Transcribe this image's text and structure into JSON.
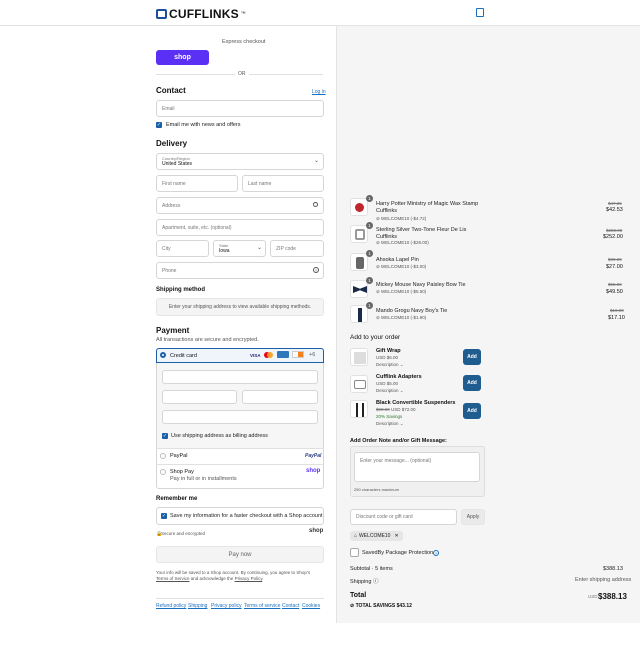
{
  "header": {
    "logo": "CUFFLINKS",
    "logo_suffix": "™",
    "cart_icon": "bag-icon"
  },
  "express": {
    "label": "Express checkout",
    "shop_button": "shop",
    "or": "OR"
  },
  "contact": {
    "title": "Contact",
    "login": "Log in",
    "email_placeholder": "Email",
    "news_label": "Email me with news and offers"
  },
  "delivery": {
    "title": "Delivery",
    "country_label": "Country/Region",
    "country_value": "United States",
    "first_name": "First name",
    "last_name": "Last name",
    "address": "Address",
    "apartment": "Apartment, suite, etc. (optional)",
    "city": "City",
    "state_label": "State",
    "state_value": "Iowa",
    "zip": "ZIP code",
    "phone": "Phone"
  },
  "shipping": {
    "title": "Shipping method",
    "message": "Enter your shipping address to view available shipping methods."
  },
  "payment": {
    "title": "Payment",
    "subtitle": "All transactions are secure and encrypted.",
    "credit_card": "Credit card",
    "more_cards": "+6",
    "billing_label": "Use shipping address as billing address",
    "paypal": "PayPal",
    "paypal_logo": "PayPal",
    "shop_pay": "Shop Pay",
    "shop_pay_sub": "Pay in full or in installments",
    "shop_pay_logo": "shop"
  },
  "remember": {
    "title": "Remember me",
    "save_label": "Save my information for a faster checkout with a Shop account",
    "secure": "Secure and encrypted",
    "shop_logo": "shop"
  },
  "pay_now": "Pay now",
  "legal": {
    "line1": "Your info will be saved to a Shop account. By continuing, you agree to Shop’s",
    "terms": "Terms of Service",
    "and": " and acknowledge the ",
    "privacy": "Privacy Policy",
    "end": "."
  },
  "footer_links": [
    "Refund policy",
    "Shipping",
    "Privacy policy",
    "Terms of service",
    "Contact",
    "Cookies"
  ],
  "order": {
    "items": [
      {
        "name": "Harry Potter Ministry of Magic Wax Stamp Cufflinks",
        "qty": "1",
        "discount": "WELCOME10 (-$4.72)",
        "old": "$47.25",
        "price": "$42.53"
      },
      {
        "name": "Sterling Silver Two-Tone Fleur De Lis Cufflinks",
        "qty": "1",
        "discount": "WELCOME10 (-$28.00)",
        "old": "$280.00",
        "price": "$252.00"
      },
      {
        "name": "Ahsoka Lapel Pin",
        "qty": "1",
        "discount": "WELCOME10 (-$3.00)",
        "old": "$30.00",
        "price": "$27.00"
      },
      {
        "name": "Mickey Mouse Navy Paisley Bow Tie",
        "qty": "1",
        "discount": "WELCOME10 (-$5.50)",
        "old": "$55.00",
        "price": "$49.50"
      },
      {
        "name": "Mando Grogu Navy Boy's Tie",
        "qty": "1",
        "discount": "WELCOME10 (-$1.90)",
        "old": "$19.00",
        "price": "$17.10"
      }
    ],
    "add_title": "Add to your order",
    "upsells": [
      {
        "name": "Gift Wrap",
        "price": "USD $6.00",
        "old": "",
        "savings": "",
        "desc": "Description",
        "btn": "Add"
      },
      {
        "name": "Cufflink Adapters",
        "price": "USD $5.00",
        "old": "",
        "savings": "",
        "desc": "Description",
        "btn": "Add"
      },
      {
        "name": "Black Convertible Suspenders",
        "price": "USD $72.00",
        "old": "$90.00",
        "savings": "20% Savings",
        "desc": "Description",
        "btn": "Add"
      }
    ],
    "note_title": "Add Order Note and/or Gift Message:",
    "note_placeholder": "Enter your message... (optional)",
    "note_counter": "250 characters maximum",
    "discount_placeholder": "Discount code or gift card",
    "apply": "Apply",
    "code": "WELCOME10",
    "protection": "SavedBy Package Protection",
    "subtotal_label": "Subtotal · 5 items",
    "subtotal": "$388.13",
    "shipping_label": "Shipping",
    "shipping_value": "Enter shipping address",
    "total_label": "Total",
    "currency": "USD",
    "total": "$388.13",
    "savings_label": "TOTAL SAVINGS",
    "savings": "$43.12"
  }
}
